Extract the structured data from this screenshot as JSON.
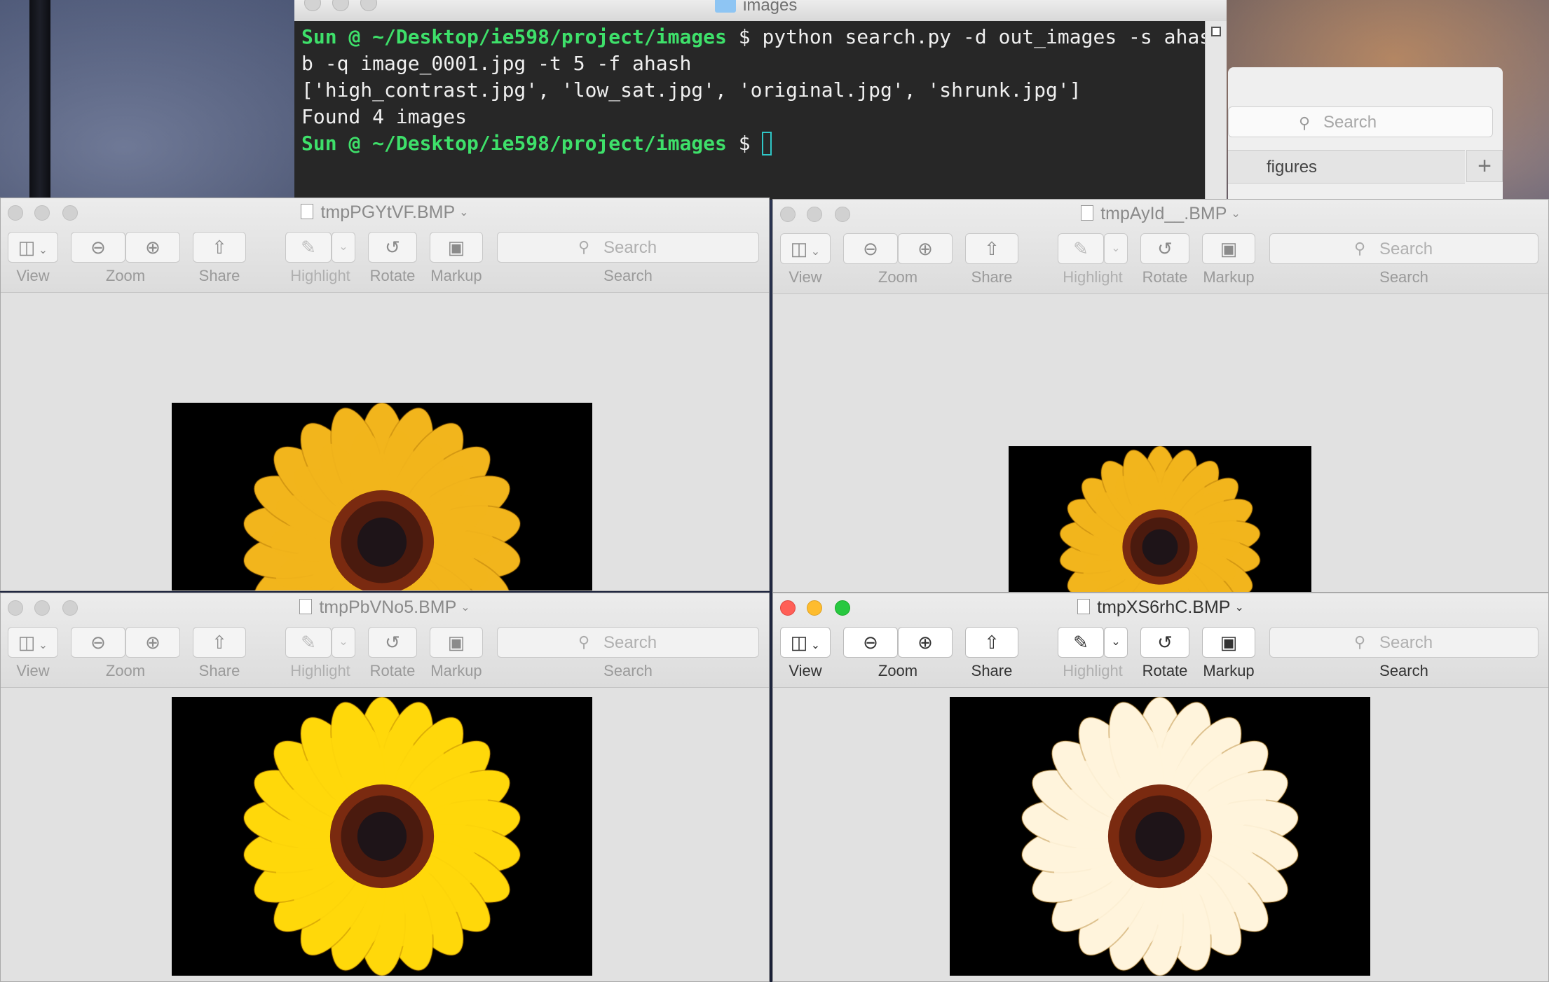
{
  "terminal": {
    "window_title": "images",
    "lines": [
      {
        "prompt": "Sun @ ~/Desktop/ie598/project/images",
        "text": " $ python search.py -d out_images -s ahash.d"
      },
      {
        "prompt": "",
        "text": "b -q image_0001.jpg -t 5 -f ahash"
      },
      {
        "prompt": "",
        "text": "['high_contrast.jpg', 'low_sat.jpg', 'original.jpg', 'shrunk.jpg']"
      },
      {
        "prompt": "",
        "text": "Found 4 images"
      },
      {
        "prompt": "Sun @ ~/Desktop/ie598/project/images",
        "text": " $ "
      }
    ]
  },
  "finder": {
    "search_placeholder": "Search",
    "tab_label": "figures",
    "add_tab": "+"
  },
  "toolbar": {
    "view": "View",
    "zoom": "Zoom",
    "share": "Share",
    "highlight": "Highlight",
    "rotate": "Rotate",
    "markup": "Markup",
    "search": "Search",
    "search_placeholder": "Search"
  },
  "windows": [
    {
      "title": "tmpPGYtVF.BMP",
      "active": false
    },
    {
      "title": "tmpAyId__.BMP",
      "active": false
    },
    {
      "title": "tmpPbVNo5.BMP",
      "active": false
    },
    {
      "title": "tmpXS6rhC.BMP",
      "active": true
    }
  ],
  "colors": {
    "prompt": "#3ee06a",
    "petals_original": "#f2b51c",
    "petals_saturated": "#ffd80a",
    "petals_low_sat": "#fff4dc"
  }
}
